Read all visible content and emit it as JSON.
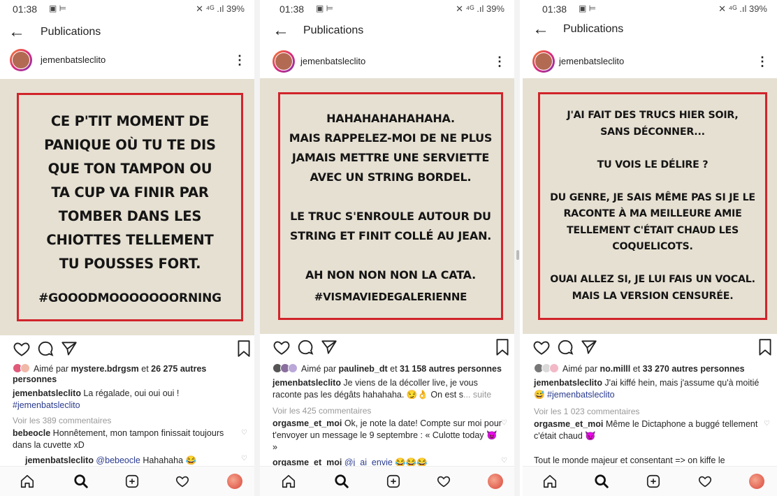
{
  "panels": [
    {
      "status": {
        "time": "01:38",
        "left_icons": "▣ ⊨",
        "right": "✕ ⁴ᴳ .ıl 39%"
      },
      "header": {
        "back": "←",
        "title": "Publications"
      },
      "post_user": "jemenbatsleclito",
      "image_text": "CE P'TIT MOMENT DE\nPANIQUE OÙ TU TE DIS\nQUE TON TAMPON OU\nTA CUP VA FINIR PAR\nTOMBER DANS LES\nCHIOTTES TELLEMENT\nTU POUSSES FORT.",
      "image_tag": "#GOOODMOOOOOOORNING",
      "likes": {
        "prefix": "Aimé par ",
        "user": "mystere.bdrgsm",
        "mid": " et ",
        "count": "26 275 autres personnes"
      },
      "caption": {
        "user": "jemenbatsleclito",
        "text": " La régalade, oui oui oui ! ",
        "tag": "#jemenbatsleclito"
      },
      "view_comments": "Voir les 389 commentaires",
      "comments": [
        {
          "user": "bebeocle",
          "text": " Honnêtement, mon tampon finissait toujours dans la cuvette xD"
        },
        {
          "user": "jemenbatsleclito",
          "mention": " @bebeocle",
          "text": " Hahahaha 😂"
        }
      ]
    },
    {
      "status": {
        "time": "01:38",
        "left_icons": "▣ ⊨",
        "right": "✕ ⁴ᴳ .ıl 39%"
      },
      "header": {
        "back": "←",
        "title": "Publications"
      },
      "post_user": "jemenbatsleclito",
      "image_text": "HAHAHAHAHAHAHA.\nMAIS RAPPELEZ-MOI DE NE PLUS\nJAMAIS METTRE UNE SERVIETTE\nAVEC UN STRING BORDEL.\n\nLE TRUC S'ENROULE AUTOUR DU\nSTRING ET FINIT COLLÉ AU JEAN.\n\nAH NON NON NON LA CATA.",
      "image_tag": "#VISMAVIEDEGALERIENNE",
      "likes": {
        "prefix": "Aimé par ",
        "user": "paulineb_dt",
        "mid": " et ",
        "count": "31 158 autres personnes"
      },
      "caption": {
        "user": "jemenbatsleclito",
        "text": " Je viens de la décoller live, je vous raconte pas les dégâts hahahaha. 😏👌 On est s",
        "more": "... suite"
      },
      "view_comments": "Voir les 425 commentaires",
      "comments": [
        {
          "user": "orgasme_et_moi",
          "text": " Ok, je note la date! Compte sur moi pour t'envoyer un message le 9 septembre : « Culotte today 😈 »"
        },
        {
          "user": "orgasme_et_moi",
          "mention": " @j_ai_envie",
          "text": " 😂😂😂"
        }
      ]
    },
    {
      "status": {
        "time": "01:38",
        "left_icons": "▣ ⊨",
        "right": "✕ ⁴ᴳ .ıl 39%"
      },
      "header": {
        "back": "←",
        "title": "Publications"
      },
      "post_user": "jemenbatsleclito",
      "image_text": "J'AI FAIT DES TRUCS HIER SOIR,\nSANS DÉCONNER...\n\nTU VOIS LE DÉLIRE ?\n\nDU GENRE, JE SAIS MÊME PAS SI JE LE\nRACONTE À MA MEILLEURE AMIE\nTELLEMENT C'ÉTAIT CHAUD LES\nCOQUELICOTS.\n\nOUAI ALLEZ SI, JE LUI FAIS UN VOCAL.\nMAIS LA VERSION CENSURÉE.",
      "image_tag": "",
      "likes": {
        "prefix": "Aimé par ",
        "user": "no.milll",
        "mid": " et ",
        "count": "33 270 autres personnes"
      },
      "caption": {
        "user": "jemenbatsleclito",
        "text": " J'ai kiffé hein, mais j'assume qu'à moitié 😅 ",
        "tag": "#jemenbatsleclito"
      },
      "view_comments": "Voir les 1 023 commentaires",
      "comments": [
        {
          "user": "orgasme_et_moi",
          "text": " Même le Dictaphone a buggé tellement c'était chaud 😈"
        },
        {
          "user": "",
          "text": "Tout le monde majeur et consentant => on kiffe le"
        }
      ]
    }
  ],
  "colors": {
    "frame": "#d1242b",
    "image_bg": "#e6e0d2",
    "hashtag": "#2a3b8f"
  },
  "icons": [
    "heart-icon",
    "comment-icon",
    "share-icon",
    "bookmark-icon",
    "home-icon",
    "search-icon",
    "add-post-icon",
    "activity-icon",
    "profile-avatar"
  ]
}
